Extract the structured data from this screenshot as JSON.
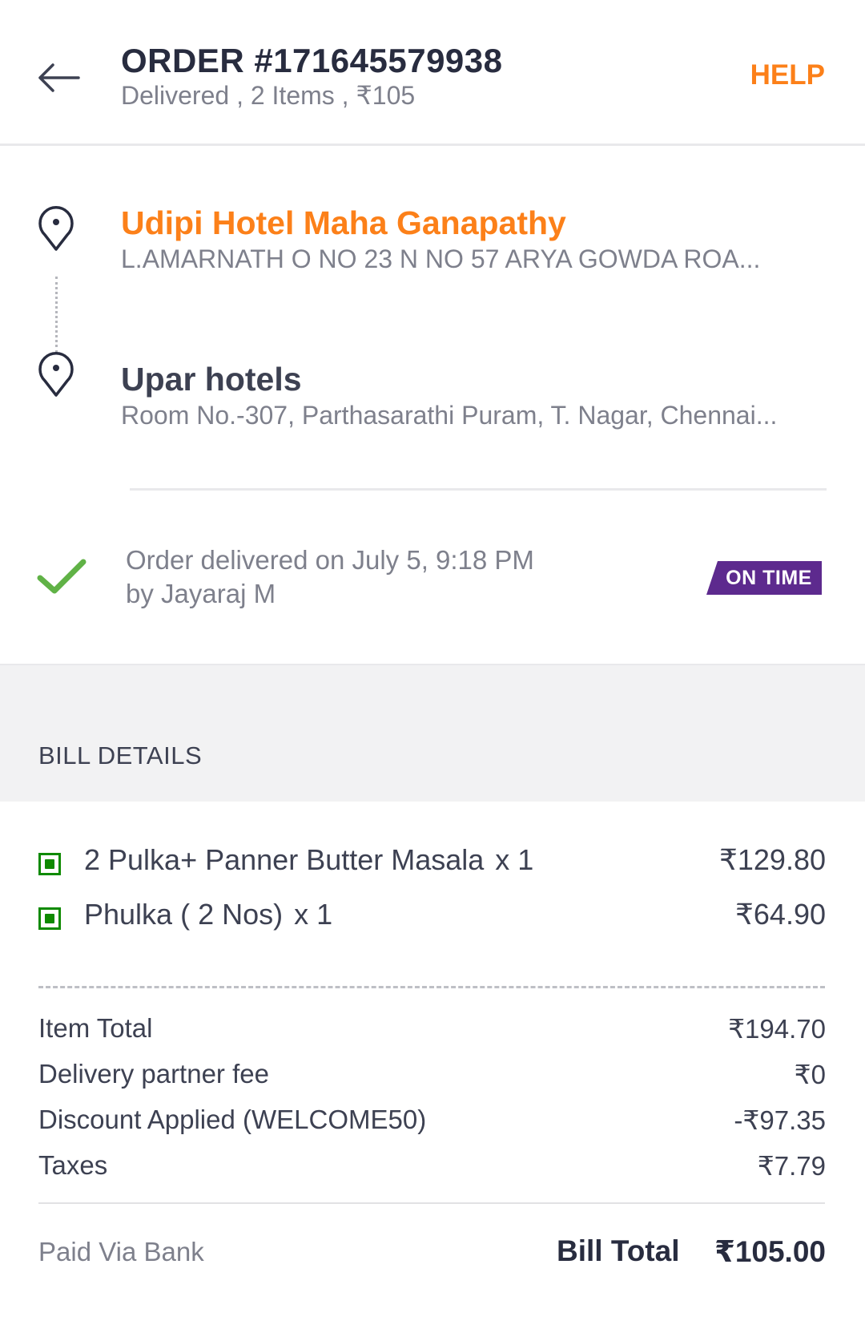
{
  "header": {
    "title": "ORDER #171645579938",
    "subtitle": "Delivered , 2 Items , ₹105",
    "help_label": "HELP",
    "back_icon": "arrow-left-icon"
  },
  "route": {
    "restaurant": {
      "name": "Udipi Hotel Maha Ganapathy",
      "address": "L.AMARNATH O NO 23 N NO 57 ARYA GOWDA ROA..."
    },
    "destination": {
      "name": "Upar hotels",
      "address": "Room No.-307, Parthasarathi Puram, T. Nagar, Chennai..."
    },
    "pin_icon": "location-pin-icon"
  },
  "delivery": {
    "line1": "Order delivered on July 5, 9:18 PM",
    "line2": "by Jayaraj M",
    "badge": "ON TIME",
    "check_icon": "checkmark-icon"
  },
  "bill": {
    "heading": "BILL DETAILS",
    "items": [
      {
        "name": "2 Pulka+ Panner Butter Masala",
        "qty": "x 1",
        "price": "₹129.80"
      },
      {
        "name": "Phulka ( 2 Nos)",
        "qty": "x 1",
        "price": "₹64.90"
      }
    ],
    "charges": [
      {
        "label": "Item Total",
        "value": "₹194.70"
      },
      {
        "label": "Delivery partner fee",
        "value": "₹0"
      },
      {
        "label": "Discount Applied (WELCOME50)",
        "value": "-₹97.35"
      },
      {
        "label": "Taxes",
        "value": "₹7.79"
      }
    ],
    "paid_via": "Paid Via Bank",
    "total_label": "Bill Total",
    "total_value": "₹105.00"
  },
  "colors": {
    "accent": "#fc8019",
    "badge": "#5d2a8e",
    "veg": "#0f8a00",
    "check": "#60b246"
  }
}
